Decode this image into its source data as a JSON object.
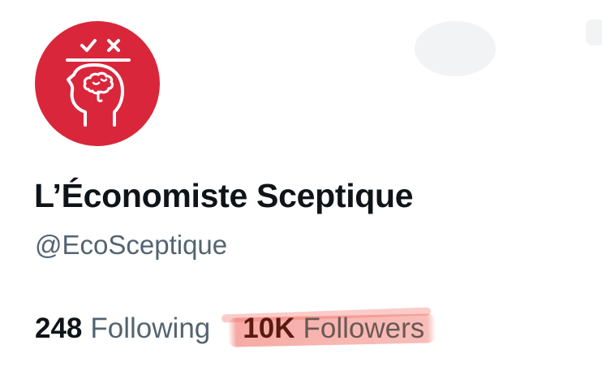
{
  "profile": {
    "display_name": "L’Économiste Sceptique",
    "handle": "@EcoSceptique",
    "avatar_color": "#d9263b"
  },
  "stats": {
    "following_count": "248",
    "following_label": "Following",
    "followers_count": "10K",
    "followers_label": "Followers",
    "highlight_color": "#f06e64"
  },
  "icons": {
    "avatar": "head-brain-check-cross-icon"
  }
}
